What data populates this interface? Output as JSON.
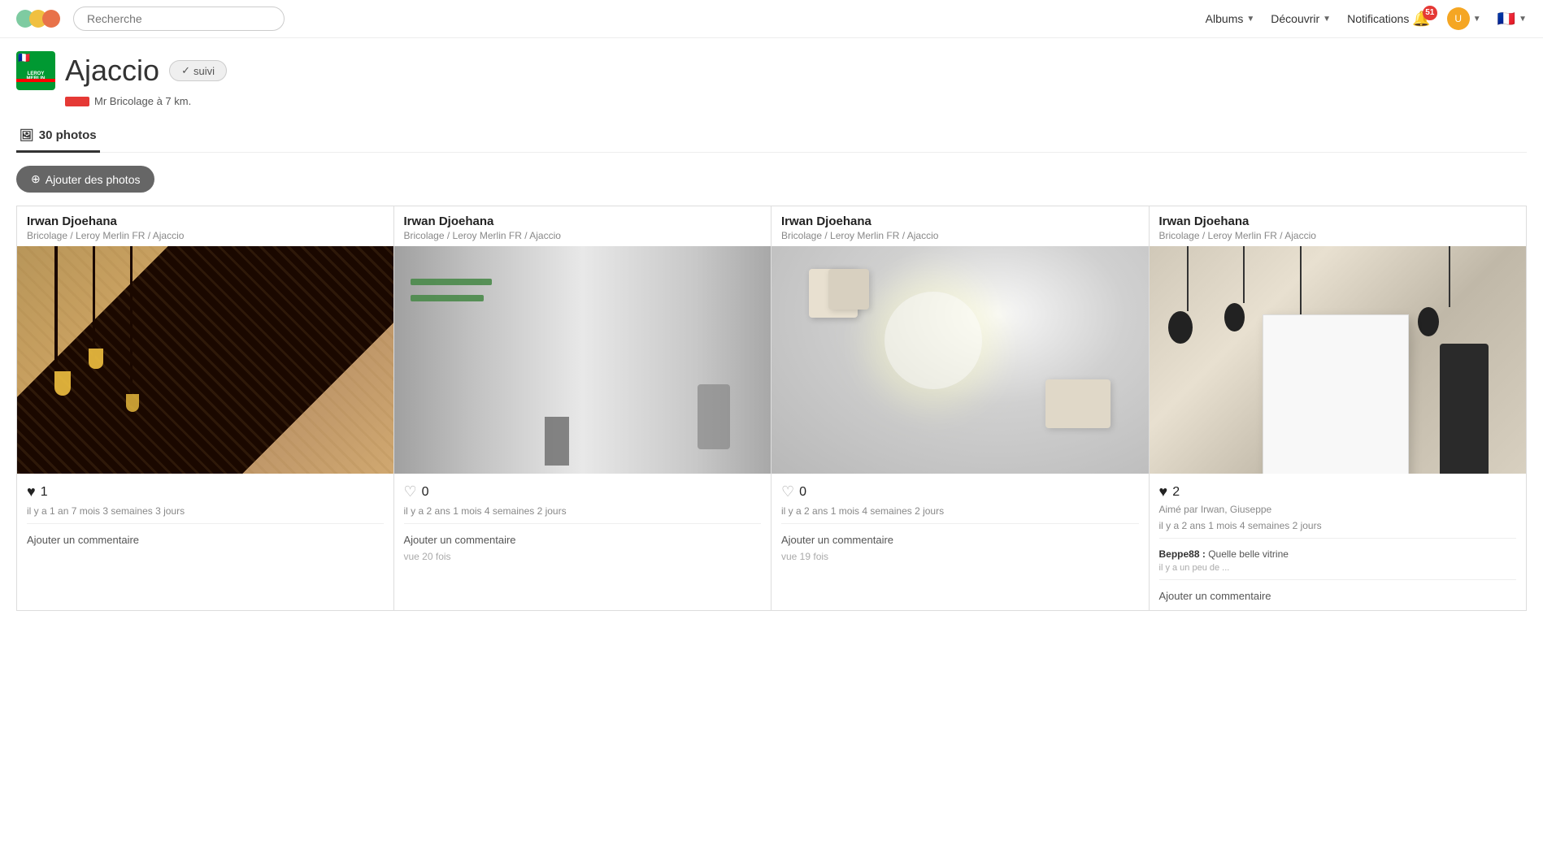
{
  "header": {
    "search_placeholder": "Recherche",
    "nav_albums": "Albums",
    "nav_discover": "Découvrir",
    "nav_notifications": "Notifications",
    "notif_count": "51",
    "flag": "🇫🇷"
  },
  "page": {
    "brand_flag": "🇫🇷",
    "brand_name": "LEROY\nMERLIN",
    "city": "Ajaccio",
    "follow_label": "suivi",
    "nearby_store": "Mr Bricolage à 7 km.",
    "tab_label": "30 photos",
    "add_photos_label": "Ajouter des photos"
  },
  "photos": [
    {
      "author": "Irwan Djoehana",
      "path": "Bricolage / Leroy Merlin FR / Ajaccio",
      "likes": 1,
      "heart": "filled",
      "timestamp": "il y a 1 an 7 mois 3 semaines 3 jours",
      "comment_prompt": "Ajouter un commentaire",
      "liked_by": "",
      "comment_text": "",
      "comment_author": "",
      "comment_date": "",
      "view_count": ""
    },
    {
      "author": "Irwan Djoehana",
      "path": "Bricolage / Leroy Merlin FR / Ajaccio",
      "likes": 0,
      "heart": "empty",
      "timestamp": "il y a 2 ans 1 mois 4 semaines 2 jours",
      "comment_prompt": "Ajouter un commentaire",
      "liked_by": "",
      "comment_text": "",
      "comment_author": "",
      "comment_date": "",
      "view_count": "vue 20 fois"
    },
    {
      "author": "Irwan Djoehana",
      "path": "Bricolage / Leroy Merlin FR / Ajaccio",
      "likes": 0,
      "heart": "empty",
      "timestamp": "il y a 2 ans 1 mois 4 semaines 2 jours",
      "comment_prompt": "Ajouter un commentaire",
      "liked_by": "",
      "comment_text": "",
      "comment_author": "",
      "comment_date": "",
      "view_count": "vue 19 fois"
    },
    {
      "author": "Irwan Djoehana",
      "path": "Bricolage / Leroy Merlin FR / Ajaccio",
      "likes": 2,
      "heart": "filled",
      "timestamp": "il y a 2 ans 1 mois 4 semaines 2 jours",
      "liked_by": "Aimé par Irwan, Giuseppe",
      "comment_prompt": "Ajouter un commentaire",
      "comment_text": "Quelle belle vitrine",
      "comment_author": "Beppe88 :",
      "comment_date": "il y a un peu de ...",
      "view_count": ""
    }
  ]
}
